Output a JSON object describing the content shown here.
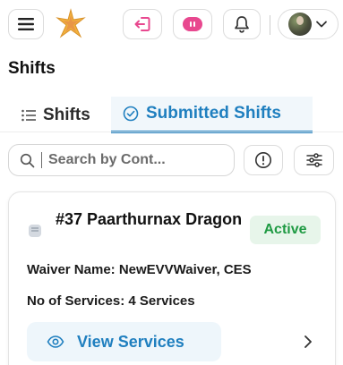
{
  "header": {
    "menu_icon": "hamburger-menu-icon",
    "logo_icon": "star-logo-icon",
    "logout_icon": "logout-icon",
    "pill_icon": "pause-pill-icon",
    "bell_icon": "bell-icon",
    "profile_chevron": "chevron-down-icon",
    "accent_pink": "#e8488f"
  },
  "page": {
    "title": "Shifts"
  },
  "tabs": [
    {
      "label": "Shifts",
      "icon": "list-icon",
      "active": false
    },
    {
      "label": "Submitted Shifts",
      "icon": "check-circle-icon",
      "active": true
    }
  ],
  "search": {
    "placeholder": "Search by Cont..."
  },
  "toolbar": {
    "info_icon": "info-icon",
    "filter_icon": "sliders-icon"
  },
  "card": {
    "title": "#37 Paarthurnax Dragon",
    "status": "Active",
    "waiver_label": "Waiver Name:",
    "waiver_value": "NewEVVWaiver, CES",
    "services_label": "No of Services:",
    "services_value": "4 Services",
    "view_label": "View Services",
    "accent": "#1f7fbf",
    "status_color": "#1f9a43"
  }
}
